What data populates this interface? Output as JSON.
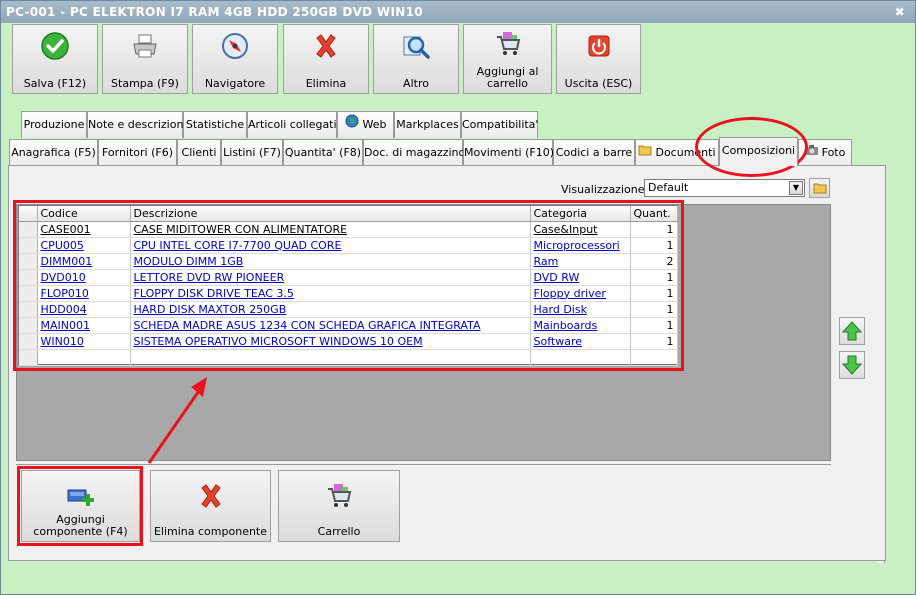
{
  "window": {
    "title": "PC-001 - PC ELEKTRON I7 RAM 4GB HDD 250GB DVD WIN10",
    "close_glyph": "✖"
  },
  "toolbar": {
    "save": "Salva (F12)",
    "print": "Stampa (F9)",
    "navigator": "Navigatore",
    "delete": "Elimina",
    "other": "Altro",
    "add_cart": "Aggiungi al carrello",
    "exit": "Uscita (ESC)"
  },
  "tabs_row1": [
    "Produzione",
    "Note e descrizioni",
    "Statistiche",
    "Articoli collegati",
    "Web",
    "Markplaces",
    "Compatibilita'"
  ],
  "tabs_row2": [
    "Anagrafica (F5)",
    "Fornitori (F6)",
    "Clienti",
    "Listini (F7)",
    "Quantita' (F8)",
    "Doc. di magazzino",
    "Movimenti (F10)",
    "Codici a barre",
    "Documenti",
    "Composizioni",
    "Foto"
  ],
  "view": {
    "label": "Visualizzazione :",
    "value": "Default"
  },
  "grid": {
    "columns": [
      "Codice",
      "Descrizione",
      "Categoria",
      "Quant."
    ],
    "rows": [
      [
        "CASE001",
        "CASE MIDITOWER CON ALIMENTATORE",
        "Case&Input",
        "1"
      ],
      [
        "CPU005",
        "CPU INTEL CORE I7-7700 QUAD CORE",
        "Microprocessori",
        "1"
      ],
      [
        "DIMM001",
        "MODULO DIMM 1GB",
        "Ram",
        "2"
      ],
      [
        "DVD010",
        "LETTORE DVD RW PIONEER",
        "DVD RW",
        "1"
      ],
      [
        "FLOP010",
        "FLOPPY DISK DRIVE TEAC 3.5",
        "Floppy driver",
        "1"
      ],
      [
        "HDD004",
        "HARD DISK MAXTOR 250GB",
        "Hard Disk",
        "1"
      ],
      [
        "MAIN001",
        "SCHEDA MADRE ASUS 1234 CON SCHEDA GRAFICA INTEGRATA",
        "Mainboards",
        "1"
      ],
      [
        "WIN010",
        "SISTEMA OPERATIVO MICROSOFT WINDOWS 10 OEM",
        "Software",
        "1"
      ]
    ]
  },
  "bottom": {
    "add_component": "Aggiungi componente (F4)",
    "delete_component": "Elimina componente",
    "cart": "Carrello"
  },
  "colors": {
    "highlight": "#e8131c",
    "background": "#c9f0c3"
  }
}
